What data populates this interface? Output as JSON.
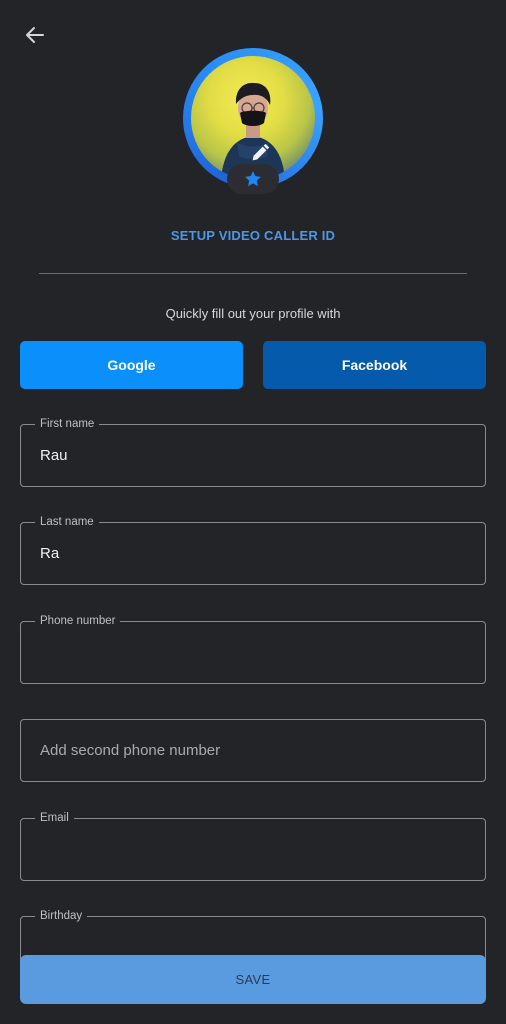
{
  "header": {
    "back_icon": "arrow-left-icon"
  },
  "profile": {
    "avatar_icon": "avatar-illustration",
    "edit_icon": "pencil-icon",
    "badge_icon": "star-icon",
    "ring_color": "#2a8cf6",
    "setup_link": "SETUP VIDEO CALLER ID"
  },
  "quick_fill": {
    "text": "Quickly fill out your profile with",
    "google_label": "Google",
    "facebook_label": "Facebook",
    "google_color": "#0a8ffb",
    "facebook_color": "#055aab"
  },
  "form": {
    "first_name": {
      "label": "First name",
      "value": "Rau"
    },
    "last_name": {
      "label": "Last name",
      "value": "Ra"
    },
    "phone": {
      "label": "Phone number",
      "value": ""
    },
    "second_phone": {
      "placeholder": "Add second phone number"
    },
    "email": {
      "label": "Email",
      "value": ""
    },
    "birthday": {
      "label": "Birthday",
      "value": ""
    }
  },
  "footer": {
    "save_label": "SAVE",
    "save_color": "#5a9be0"
  }
}
